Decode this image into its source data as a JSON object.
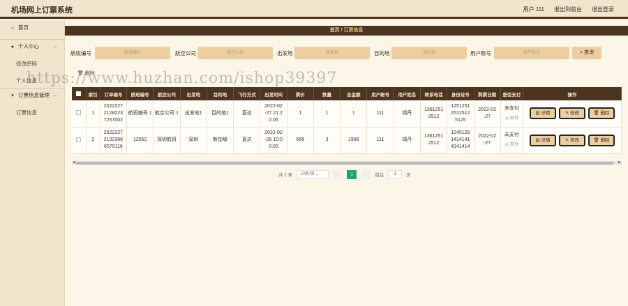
{
  "app": {
    "title": "机场网上订票系统",
    "user_label": "用户 111",
    "back_label": "退出到前台",
    "logout_label": "退出登录"
  },
  "sidebar": {
    "items": [
      {
        "label": "首页",
        "icon": "home-icon"
      },
      {
        "label": "个人中心",
        "icon": "user-icon"
      },
      {
        "label": "修改密码"
      },
      {
        "label": "个人信息"
      },
      {
        "label": "订票信息管理",
        "icon": "ticket-icon"
      },
      {
        "label": "订票信息"
      }
    ]
  },
  "breadcrumb": {
    "home": "首页",
    "sep": "/",
    "current": "订票信息"
  },
  "search": {
    "fields": [
      {
        "label": "航班编号",
        "placeholder": "航班编号"
      },
      {
        "label": "航空公司",
        "placeholder": "航空公司"
      },
      {
        "label": "出发地",
        "placeholder": "出发地"
      },
      {
        "label": "目的地",
        "placeholder": "目的地"
      },
      {
        "label": "用户账号",
        "placeholder": "用户账号"
      }
    ],
    "query_label": "查询"
  },
  "toolbar": {
    "delete_label": "删除"
  },
  "table": {
    "headers": [
      "索引",
      "订单编号",
      "航班编号",
      "航空公司",
      "出发地",
      "目的地",
      "飞行方式",
      "出发时间",
      "票价",
      "数量",
      "总金额",
      "用户账号",
      "用户姓名",
      "联系电话",
      "身份证号",
      "购票日期",
      "是否支付",
      "操作"
    ],
    "rows": [
      {
        "index": "1",
        "order_no": "2022227 2128223 7257002",
        "flight_no": "航班编号 1",
        "airline": "航空公司 1",
        "from": "出发地1",
        "to": "目的地1",
        "mode": "直达",
        "depart": "2022-02 -27 21:2 0:06",
        "price": "1",
        "qty": "1",
        "total": "1",
        "account": "111",
        "name": "靖丹",
        "phone": "1361251 2512",
        "id_no": "1251251 2512512 5125",
        "date": "2022-02 -27",
        "paid": "未支付",
        "pay_link": "支付"
      },
      {
        "index": "2",
        "order_no": "2022227 2132368 6570116",
        "flight_no": "12562",
        "airline": "深圳航班",
        "from": "深圳",
        "to": "新加坡",
        "mode": "直达",
        "depart": "2022-02 -28 10:0 0:00",
        "price": "666",
        "qty": "3",
        "total": "1998",
        "account": "111",
        "name": "靖丹",
        "phone": "1361251 2512",
        "id_no": "1245125 1414141 4141414",
        "date": "2022-02 -27",
        "paid": "未支付",
        "pay_link": "支付"
      }
    ],
    "ops": {
      "detail": "详情",
      "edit": "修改",
      "delete": "删除"
    }
  },
  "pager": {
    "total": "共 2 条",
    "page_size": "10条/页",
    "prev": "‹",
    "current_page": "1",
    "next": "›",
    "goto": "前往",
    "goto_value": "1",
    "page_unit": "页"
  },
  "watermark": "https://www.huzhan.com/ishop39397"
}
